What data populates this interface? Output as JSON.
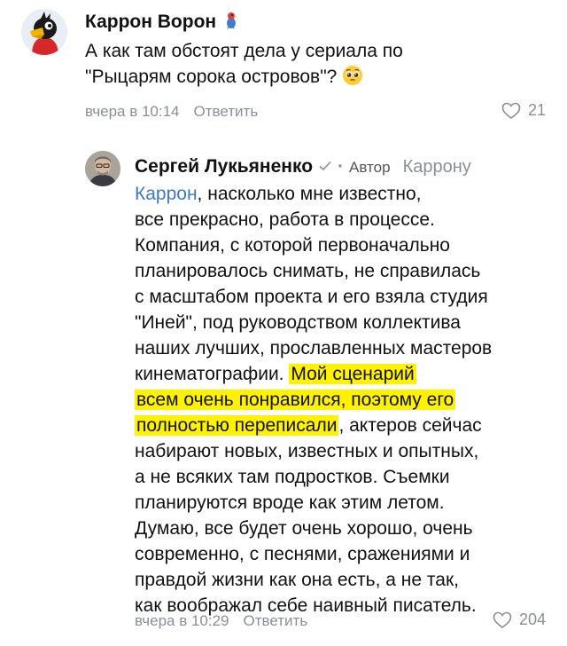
{
  "comments": [
    {
      "author": "Каррон Ворон",
      "text_lines": [
        "А как там обстоят дела у сериала по",
        "\"Рыцарям сорока островов\"?"
      ],
      "time": "вчера в 10:14",
      "reply_label": "Ответить",
      "likes": "21"
    },
    {
      "author": "Сергей Лукьяненко",
      "badge": "Автор",
      "reply_to": "Каррону",
      "mention": "Каррон",
      "line1_rest": ", насколько мне известно,",
      "lines_before_highlight": [
        "все прекрасно, работа в процессе.",
        "Компания, с которой первоначально",
        "планировалось снимать, не справилась",
        "с масштабом проекта и его взяла студия",
        "\"Иней\", под руководством коллектива",
        "наших лучших, прославленных мастеров"
      ],
      "line8_text": "кинематографии.",
      "highlight_1": "Мой сценарий",
      "highlight_2": "всем очень понравился, поэтому его",
      "highlight_3": "полностью переписали",
      "line10_rest": ", актеров сейчас",
      "lines_after_highlight": [
        "набирают новых, известных и опытных,",
        "а не всяких там подростков. Съемки",
        "планируются вроде как этим летом.",
        "Думаю, все будет очень хорошо, очень",
        "современно, с песнями, сражениями и",
        "правдой жизни как она есть, а не так,",
        "как воображал себе наивный писатель."
      ],
      "time": "вчера в 10:29",
      "reply_label": "Ответить",
      "likes": "204"
    }
  ],
  "icons": {
    "like": "heart-outline-icon",
    "verified": "checkmark-icon"
  },
  "colors": {
    "mention": "#3d79c7",
    "highlight": "#fff200",
    "meta": "#8a8f96"
  }
}
